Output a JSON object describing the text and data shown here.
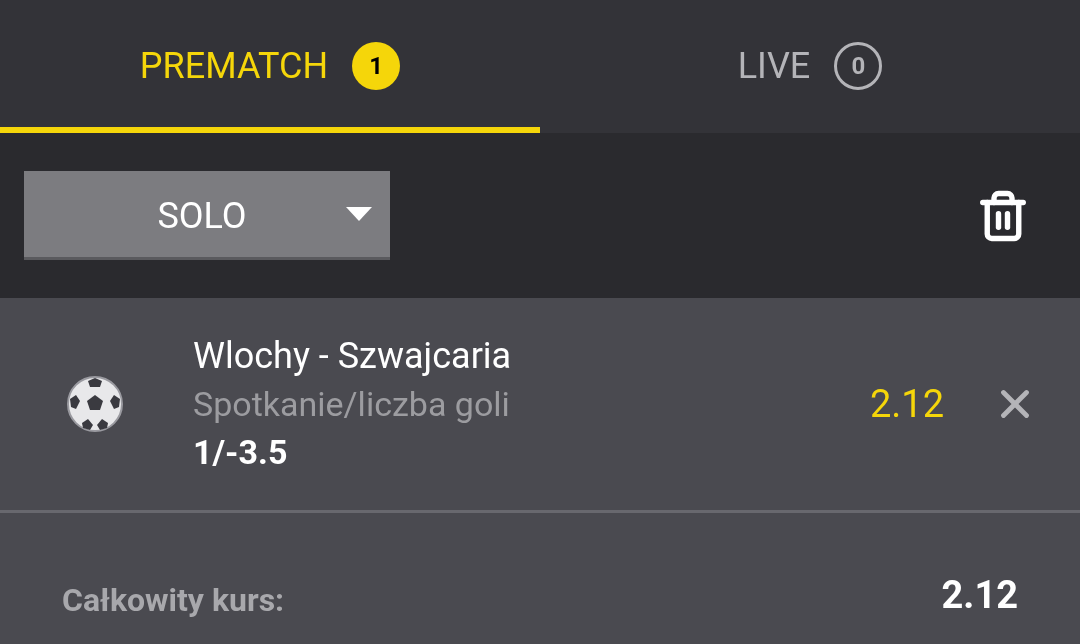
{
  "tabs": [
    {
      "label": "PREMATCH",
      "count": "1",
      "selected": true
    },
    {
      "label": "LIVE",
      "count": "0",
      "selected": false
    }
  ],
  "bet_type": {
    "value": "SOLO"
  },
  "bets": [
    {
      "event": "Wlochy - Szwajcaria",
      "market": "Spotkanie/liczba goli",
      "selection": "1/-3.5",
      "odds": "2.12"
    }
  ],
  "total": {
    "label": "Całkowity kurs:",
    "value": "2.12"
  }
}
